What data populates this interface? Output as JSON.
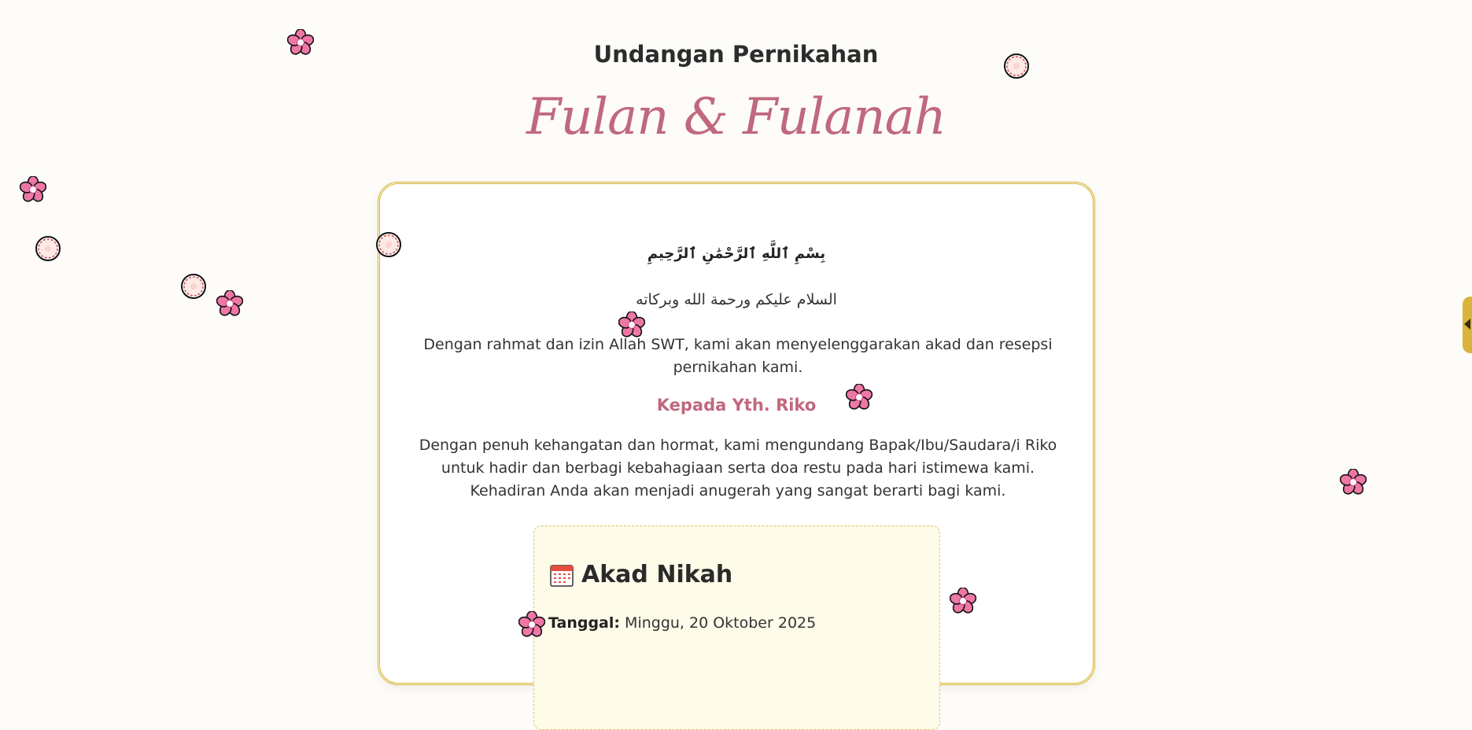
{
  "header": {
    "subtitle": "Undangan Pernikahan",
    "couple_names": "Fulan & Fulanah"
  },
  "card": {
    "bismillah": "بِسْمِ ٱللَّهِ ٱلرَّحْمَٰنِ ٱلرَّحِيمِ",
    "salam": "السلام عليكم ورحمة الله وبركاته",
    "intro": "Dengan rahmat dan izin Allah SWT, kami akan menyelenggarakan akad dan resepsi pernikahan kami.",
    "recipient": "Kepada Yth. Riko",
    "body": "Dengan penuh kehangatan dan hormat, kami mengundang Bapak/Ibu/Saudara/i Riko untuk hadir dan berbagi kebahagiaan serta doa restu pada hari istimewa kami. Kehadiran Anda akan menjadi anugerah yang sangat berarti bagi kami.",
    "event": {
      "icon": "calendar-icon",
      "title": "Akad Nikah",
      "date_label": "Tanggal:",
      "date_value": "Minggu, 20 Oktober 2025"
    }
  },
  "side_tab": {
    "icon": "chevron-left-icon"
  },
  "colors": {
    "accent_pink": "#c0687e",
    "gold_border": "#d4b12c",
    "event_bg": "#fefbe9",
    "flower_pink": "#e86a9a"
  }
}
